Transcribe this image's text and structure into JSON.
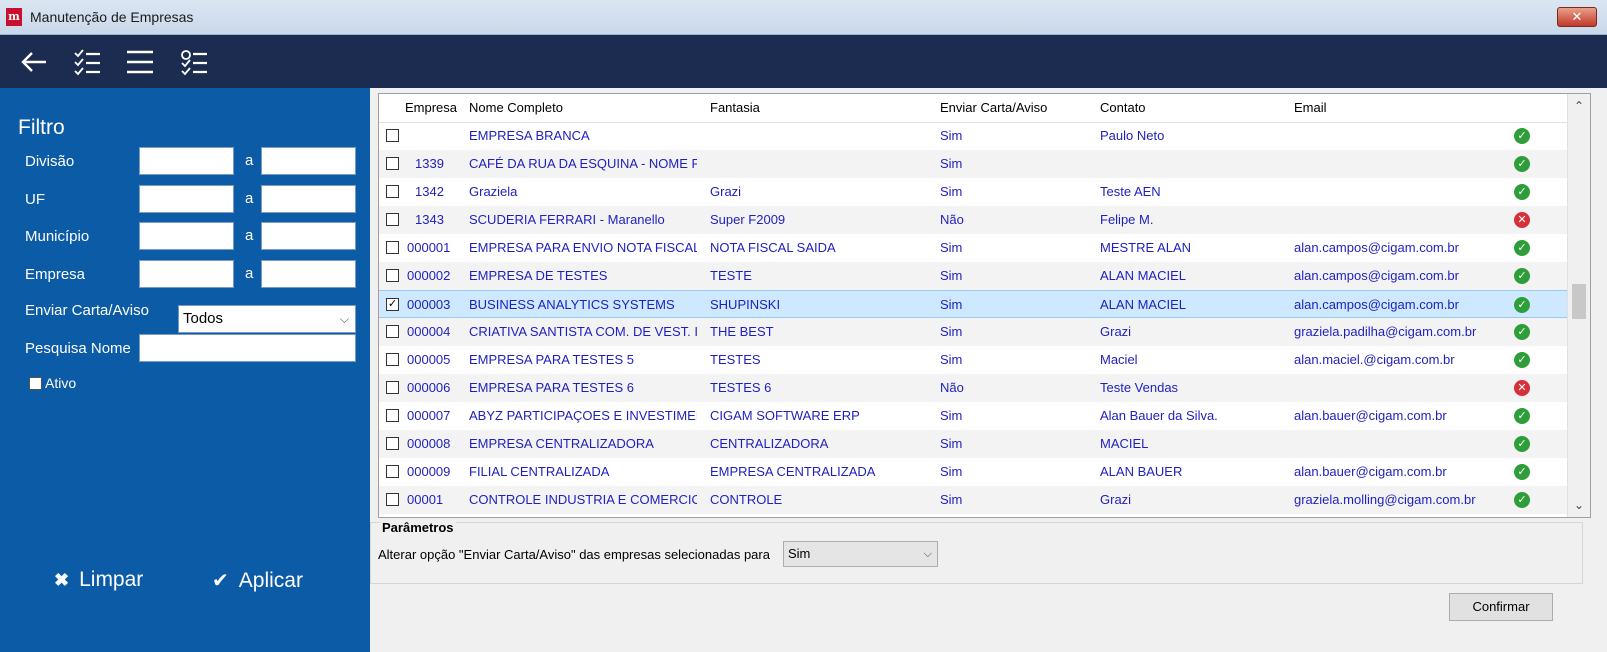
{
  "window": {
    "title": "Manutenção de Empresas",
    "close_label": "✕"
  },
  "toolbar": {
    "icons": [
      "back-arrow-icon",
      "checklist-icon",
      "menu-icon",
      "checklist-settings-icon"
    ]
  },
  "filter": {
    "title": "Filtro",
    "range_separator": "a",
    "fields": [
      {
        "label": "Divisão"
      },
      {
        "label": "UF"
      },
      {
        "label": "Município"
      },
      {
        "label": "Empresa"
      }
    ],
    "enviar_label": "Enviar Carta/Aviso",
    "enviar_value": "Todos",
    "pesquisa_label": "Pesquisa Nome",
    "ativo_label": "Ativo",
    "clear_label": "Limpar",
    "apply_label": "Aplicar"
  },
  "grid": {
    "columns": [
      "Empresa",
      "Nome Completo",
      "Fantasia",
      "Enviar Carta/Aviso",
      "Contato",
      "Email"
    ],
    "rows": [
      {
        "empresa": "",
        "nome": "EMPRESA BRANCA",
        "fantasia": "",
        "enviar": "Sim",
        "contato": "Paulo Neto",
        "email": "",
        "status": "ok",
        "checked": false
      },
      {
        "empresa": "1339",
        "nome": "CAFÉ DA RUA DA ESQUINA - NOME F.",
        "fantasia": "",
        "enviar": "Sim",
        "contato": "",
        "email": "",
        "status": "ok",
        "checked": false
      },
      {
        "empresa": "1342",
        "nome": "Graziela",
        "fantasia": "Grazi",
        "enviar": "Sim",
        "contato": "Teste AEN",
        "email": "",
        "status": "ok",
        "checked": false
      },
      {
        "empresa": "1343",
        "nome": "SCUDERIA FERRARI - Maranello",
        "fantasia": "Super F2009",
        "enviar": "Não",
        "contato": "Felipe M.",
        "email": "",
        "status": "bad",
        "checked": false
      },
      {
        "empresa": "000001",
        "nome": "EMPRESA PARA ENVIO NOTA FISCAL",
        "fantasia": "NOTA FISCAL SAIDA",
        "enviar": "Sim",
        "contato": "MESTRE ALAN",
        "email": "alan.campos@cigam.com.br",
        "status": "ok",
        "checked": false
      },
      {
        "empresa": "000002",
        "nome": "EMPRESA DE TESTES",
        "fantasia": "TESTE",
        "enviar": "Sim",
        "contato": "ALAN MACIEL",
        "email": "alan.campos@cigam.com.br",
        "status": "ok",
        "checked": false
      },
      {
        "empresa": "000003",
        "nome": "BUSINESS ANALYTICS SYSTEMS",
        "fantasia": "SHUPINSKI",
        "enviar": "Sim",
        "contato": "ALAN MACIEL",
        "email": "alan.campos@cigam.com.br",
        "status": "ok",
        "checked": true
      },
      {
        "empresa": "000004",
        "nome": "CRIATIVA SANTISTA COM. DE VEST. I",
        "fantasia": "THE BEST",
        "enviar": "Sim",
        "contato": "Grazi",
        "email": "graziela.padilha@cigam.com.br",
        "status": "ok",
        "checked": false
      },
      {
        "empresa": "000005",
        "nome": "EMPRESA PARA TESTES 5",
        "fantasia": "TESTES",
        "enviar": "Sim",
        "contato": "Maciel",
        "email": "alan.maciel.@cigam.com.br",
        "status": "ok",
        "checked": false
      },
      {
        "empresa": "000006",
        "nome": "EMPRESA PARA TESTES 6",
        "fantasia": "TESTES 6",
        "enviar": "Não",
        "contato": "Teste Vendas",
        "email": "",
        "status": "bad",
        "checked": false
      },
      {
        "empresa": "000007",
        "nome": "ABYZ PARTICIPAÇOES E INVESTIMEN",
        "fantasia": "CIGAM SOFTWARE ERP",
        "enviar": "Sim",
        "contato": "Alan Bauer da Silva.",
        "email": "alan.bauer@cigam.com.br",
        "status": "ok",
        "checked": false
      },
      {
        "empresa": "000008",
        "nome": "EMPRESA CENTRALIZADORA",
        "fantasia": "CENTRALIZADORA",
        "enviar": "Sim",
        "contato": "MACIEL",
        "email": "",
        "status": "ok",
        "checked": false
      },
      {
        "empresa": "000009",
        "nome": "FILIAL CENTRALIZADA",
        "fantasia": "EMPRESA CENTRALIZADA",
        "enviar": "Sim",
        "contato": "ALAN BAUER",
        "email": "alan.bauer@cigam.com.br",
        "status": "ok",
        "checked": false
      },
      {
        "empresa": "00001",
        "nome": "CONTROLE INDUSTRIA E COMERCIO",
        "fantasia": "CONTROLE",
        "enviar": "Sim",
        "contato": "Grazi",
        "email": "graziela.molling@cigam.com.br",
        "status": "ok",
        "checked": false
      }
    ]
  },
  "params": {
    "title": "Parâmetros",
    "label": "Alterar opção \"Enviar Carta/Aviso\" das empresas selecionadas para",
    "value": "Sim"
  },
  "confirm_label": "Confirmar"
}
